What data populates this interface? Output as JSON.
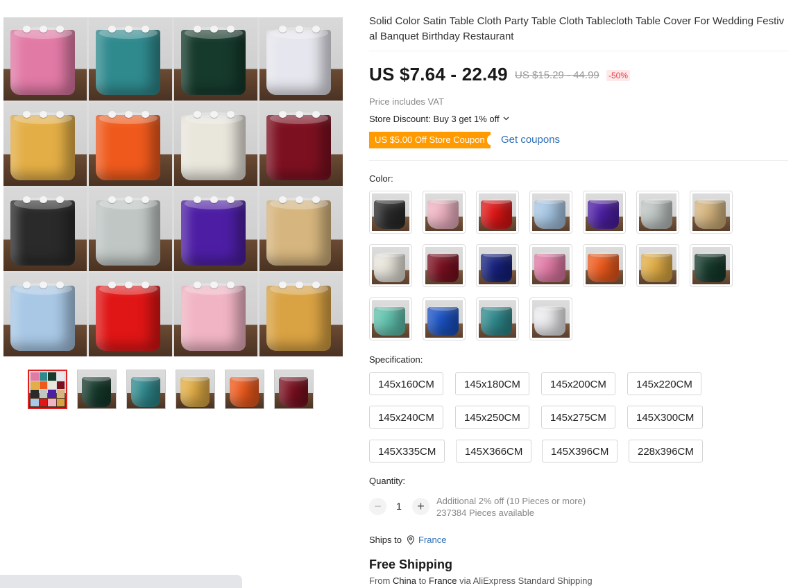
{
  "product": {
    "title": "Solid Color Satin Table Cloth Party Table Cloth Tablecloth Table Cover For Wedding Festival Banquet Birthday Restaurant",
    "price": "US $7.64 - 22.49",
    "original_price": "US $15.29 - 44.99",
    "discount_badge": "-50%",
    "vat_note": "Price includes VAT",
    "store_discount": "Store Discount: Buy 3 get 1% off",
    "coupon_label": "US $5.00 Off Store Coupon",
    "get_coupons_label": "Get coupons"
  },
  "gallery": {
    "main_image_colors": [
      "#e27aa6",
      "#2f8a8e",
      "#163a2c",
      "#e6e6ee",
      "#e3ae45",
      "#ef5a1c",
      "#e9e6dc",
      "#7c1020",
      "#2a2a2a",
      "#bfc6c4",
      "#4d1ea4",
      "#d6b57e",
      "#a8c8e6",
      "#e01515",
      "#f1b4c4",
      "#d9a243"
    ],
    "thumbnails": [
      {
        "name": "collage",
        "color": "#888888",
        "active": true
      },
      {
        "name": "dark-green",
        "color": "#163a2c",
        "active": false
      },
      {
        "name": "teal",
        "color": "#2f8a8e",
        "active": false
      },
      {
        "name": "gold",
        "color": "#e3ae45",
        "active": false
      },
      {
        "name": "orange",
        "color": "#ef5a1c",
        "active": false
      },
      {
        "name": "burgundy",
        "color": "#7c1020",
        "active": false
      }
    ]
  },
  "color": {
    "label": "Color:",
    "swatches": [
      {
        "name": "black",
        "color": "#2a2a2a"
      },
      {
        "name": "light-pink",
        "color": "#f1b4c4"
      },
      {
        "name": "red",
        "color": "#e01515"
      },
      {
        "name": "light-blue",
        "color": "#a8c8e6"
      },
      {
        "name": "purple",
        "color": "#4d1ea4"
      },
      {
        "name": "silver",
        "color": "#bfc6c4"
      },
      {
        "name": "champagne",
        "color": "#d6b57e"
      },
      {
        "name": "ivory",
        "color": "#e9e6dc"
      },
      {
        "name": "burgundy",
        "color": "#7c1020"
      },
      {
        "name": "navy",
        "color": "#16217e"
      },
      {
        "name": "pink",
        "color": "#e27aa6"
      },
      {
        "name": "orange",
        "color": "#ef5a1c"
      },
      {
        "name": "gold",
        "color": "#e3ae45"
      },
      {
        "name": "dark-green",
        "color": "#163a2c"
      },
      {
        "name": "mint",
        "color": "#5fc2ad"
      },
      {
        "name": "royal-blue",
        "color": "#1a52c4"
      },
      {
        "name": "teal",
        "color": "#2f8a8e"
      },
      {
        "name": "white",
        "color": "#ededf0"
      }
    ]
  },
  "specification": {
    "label": "Specification:",
    "options": [
      "145x160CM",
      "145x180CM",
      "145x200CM",
      "145x220CM",
      "145x240CM",
      "145x250CM",
      "145x275CM",
      "145X300CM",
      "145X335CM",
      "145X366CM",
      "145X396CM",
      "228x396CM"
    ]
  },
  "quantity": {
    "label": "Quantity:",
    "minus": "−",
    "value": "1",
    "plus": "+",
    "bulk_note": "Additional 2% off (10 Pieces or more)",
    "available": "237384 Pieces available"
  },
  "shipping": {
    "ships_to_label": "Ships to",
    "country": "France",
    "headline": "Free Shipping",
    "from_prefix": "From",
    "origin": "China",
    "to_word": "to",
    "destination": "France",
    "via": "via AliExpress Standard Shipping"
  },
  "icons": {
    "location": "map-pin-icon",
    "dropdown": "chevron-down-icon"
  }
}
